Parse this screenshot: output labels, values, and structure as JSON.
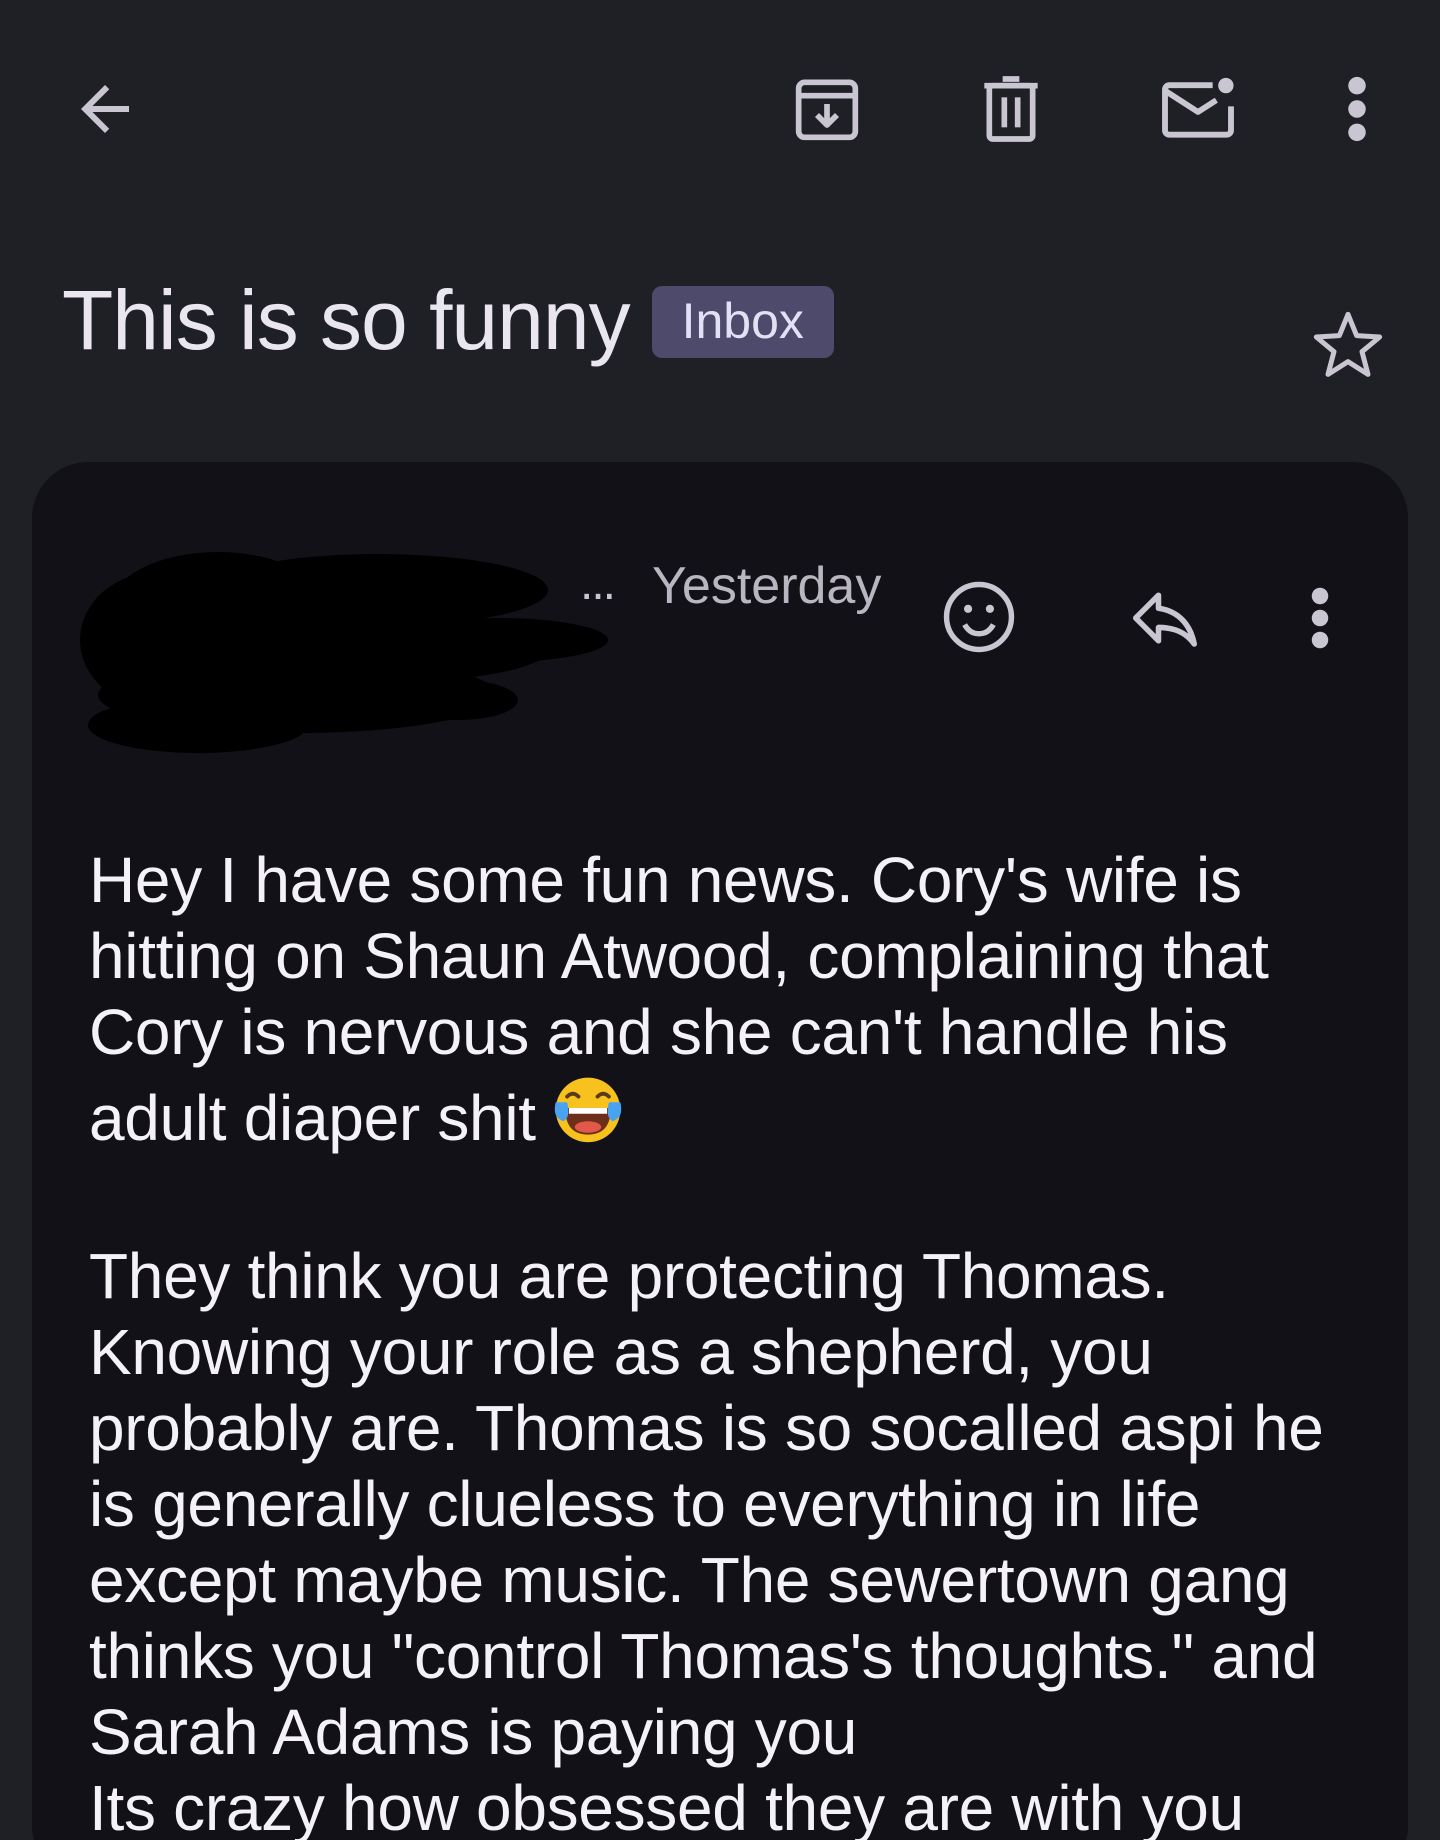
{
  "toolbar": {
    "back_icon": "arrow-left-icon",
    "archive_icon": "archive-icon",
    "delete_icon": "trash-icon",
    "mark_unread_icon": "mail-unread-icon",
    "more_icon": "more-vert-icon"
  },
  "thread": {
    "subject": "This is so funny",
    "label": "Inbox",
    "starred": false
  },
  "message": {
    "sender_redacted": true,
    "ellipsis": "...",
    "date": "Yesterday",
    "icons": [
      "emoji-reaction-icon",
      "reply-icon",
      "more-vert-icon"
    ],
    "body": {
      "p1_lines": [
        "Hey I have some fun news. Cory's wife is",
        "hitting on Shaun Atwood, complaining that",
        "Cory is nervous and she can't handle his",
        "adult diaper shit"
      ],
      "p1_emoji": "laughing-tears-emoji",
      "p2_lines": [
        "They think you are protecting Thomas.",
        "Knowing your role as a shepherd, you",
        "probably are. Thomas is so socalled aspi he",
        "is generally clueless to everything in life",
        "except maybe music. The sewertown gang",
        "thinks you \"control Thomas's thoughts.\" and",
        "Sarah Adams is paying you",
        "Its crazy how obsessed they are with you"
      ]
    }
  },
  "colors": {
    "background": "#1f1f26",
    "card": "#121117",
    "label_chip": "#4d4a6b",
    "icon": "#c9c6d2"
  }
}
